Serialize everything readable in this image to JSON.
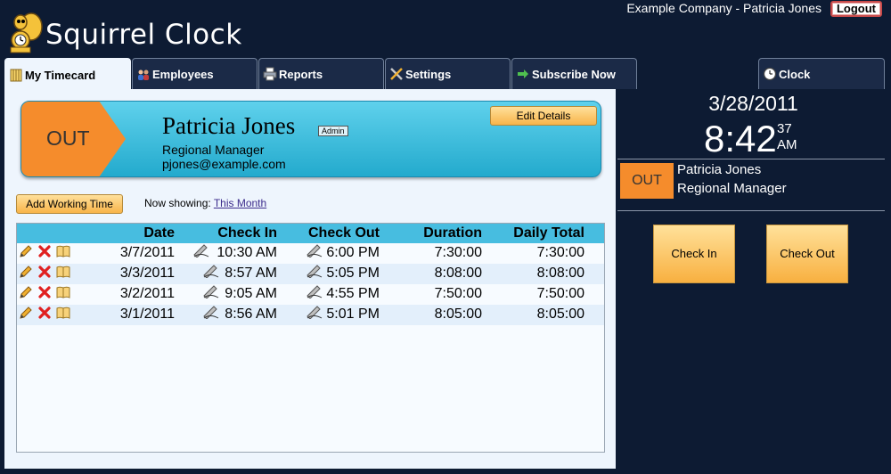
{
  "header": {
    "app_title": "Squirrel Clock",
    "company_user": "Example Company - Patricia Jones",
    "logout_label": "Logout"
  },
  "tabs": [
    {
      "label": "My Timecard",
      "icon": "timecard-icon",
      "active": true
    },
    {
      "label": "Employees",
      "icon": "people-icon"
    },
    {
      "label": "Reports",
      "icon": "printer-icon"
    },
    {
      "label": "Settings",
      "icon": "tools-icon"
    },
    {
      "label": "Subscribe Now",
      "icon": "arrow-right-icon"
    },
    {
      "label": "Clock",
      "icon": "clock-icon"
    }
  ],
  "employee": {
    "status": "OUT",
    "name": "Patricia Jones",
    "role_badge": "Admin",
    "title": "Regional Manager",
    "email": "pjones@example.com",
    "edit_label": "Edit Details"
  },
  "controls": {
    "add_working_label": "Add Working Time",
    "now_showing_label": "Now showing:",
    "period_link": "This Month"
  },
  "table": {
    "columns": [
      "Date",
      "Check In",
      "Check Out",
      "Duration",
      "Daily Total"
    ],
    "rows": [
      {
        "date": "3/7/2011",
        "check_in": "10:30 AM",
        "check_out": "6:00 PM",
        "duration": "7:30:00",
        "daily_total": "7:30:00"
      },
      {
        "date": "3/3/2011",
        "check_in": "8:57 AM",
        "check_out": "5:05 PM",
        "duration": "8:08:00",
        "daily_total": "8:08:00"
      },
      {
        "date": "3/2/2011",
        "check_in": "9:05 AM",
        "check_out": "4:55 PM",
        "duration": "7:50:00",
        "daily_total": "7:50:00"
      },
      {
        "date": "3/1/2011",
        "check_in": "8:56 AM",
        "check_out": "5:01 PM",
        "duration": "8:05:00",
        "daily_total": "8:05:00"
      }
    ]
  },
  "clock": {
    "date": "3/28/2011",
    "time": "8:42",
    "seconds": "37",
    "ampm": "AM",
    "status": "OUT",
    "name": "Patricia Jones",
    "title": "Regional Manager",
    "check_in_label": "Check In",
    "check_out_label": "Check Out"
  },
  "colors": {
    "background": "#0d1b33",
    "panel": "#eef5fd",
    "banner": "#2fb6d8",
    "status_out": "#f58c2c",
    "table_header": "#47bde0",
    "button": "#f8b44a"
  }
}
